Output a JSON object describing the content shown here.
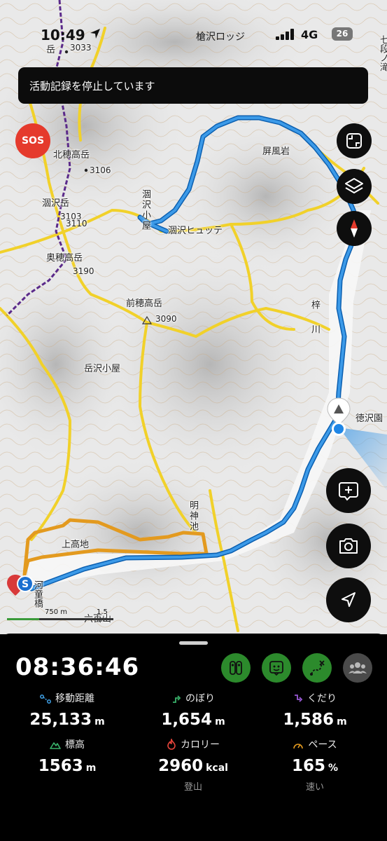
{
  "status_bar": {
    "time": "10:49",
    "location": "槍沢ロッジ",
    "network": "4G",
    "battery": "26"
  },
  "banner": {
    "text": "活動記録を停止しています"
  },
  "sos_button": {
    "label": "SOS"
  },
  "map": {
    "labels": {
      "kitaho": "北穂高岳",
      "kitaho_elev": "3106",
      "karasawa_dake": "涸沢岳",
      "karasawa_elev": "3103",
      "elev_3110": "3110",
      "okuho": "奥穂高岳",
      "okuho_elev": "3190",
      "maeho": "前穂高岳",
      "maeho_elev": "3090",
      "dakesawa": "岳沢小屋",
      "byobu": "屏風岩",
      "karasawa_hut": "涸沢ヒュッテ",
      "karasawa_goya": "涸沢小屋",
      "azusa": "梓川",
      "tokusawa": "徳沢園",
      "myojin": "明神池",
      "kamikochi": "上高地",
      "kappa": "河童橋",
      "rokuhyaku": "六百山",
      "yari_peak_top": "岳",
      "elev_3033": "3033",
      "right_edge": "七段ノ滝"
    },
    "scale": {
      "left": "750 m",
      "right": "1.5 km"
    }
  },
  "controls": [
    "fullscreen-icon",
    "layers-icon",
    "compass-icon",
    "add-memo-icon",
    "camera-icon",
    "location-arrow-icon"
  ],
  "colors": {
    "track": "#2b8fe0",
    "route": "#e39a1f",
    "trail": "#f1d12a",
    "sos": "#e53a2c",
    "chip_green": "#2c8a2c"
  },
  "stats": {
    "elapsed": "08:36:46",
    "distance": {
      "label": "移動距離",
      "value": "25,133",
      "unit": "m"
    },
    "ascent": {
      "label": "のぼり",
      "value": "1,654",
      "unit": "m"
    },
    "descent": {
      "label": "くだり",
      "value": "1,586",
      "unit": "m"
    },
    "altitude": {
      "label": "標高",
      "value": "1563",
      "unit": "m"
    },
    "calories": {
      "label": "カロリー",
      "value": "2960",
      "unit": "kcal",
      "sub": "登山"
    },
    "pace": {
      "label": "ペース",
      "value": "165",
      "unit": "%",
      "sub": "速い"
    }
  }
}
